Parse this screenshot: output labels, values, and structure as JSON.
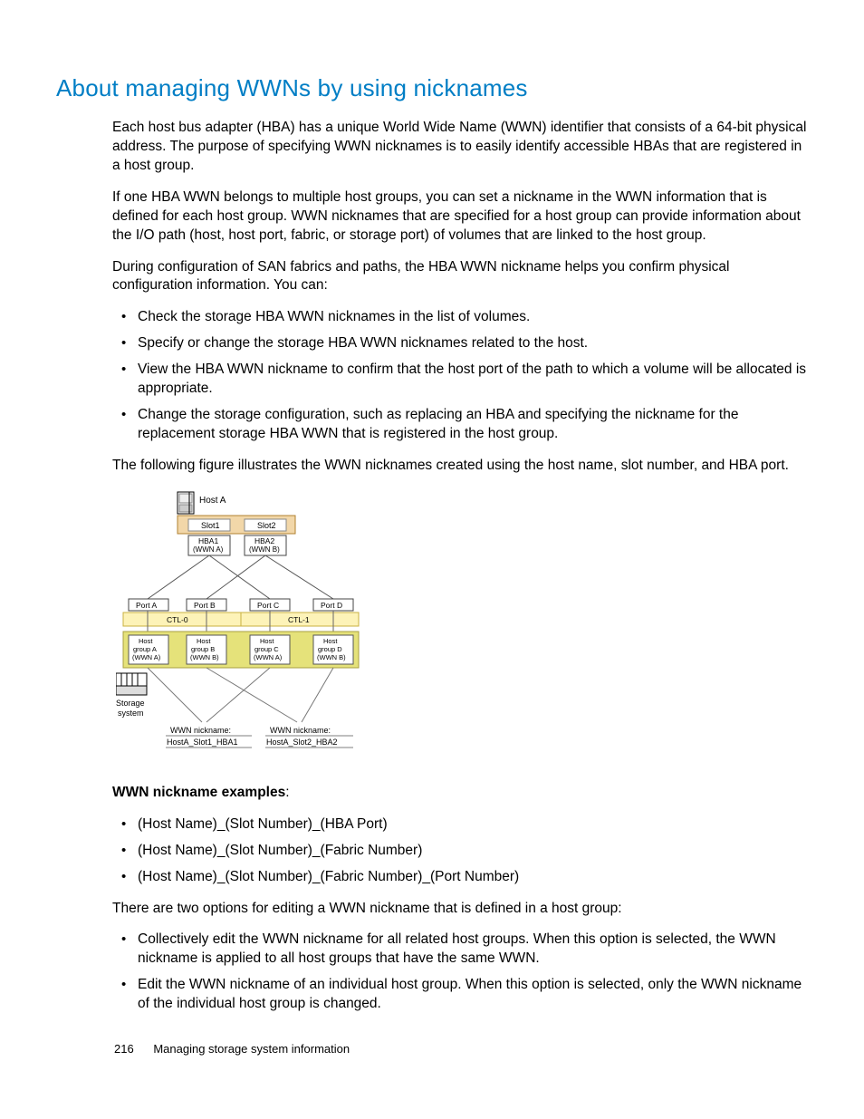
{
  "title": "About managing WWNs by using nicknames",
  "p1": "Each host bus adapter (HBA) has a unique World Wide Name (WWN) identifier that consists of a 64-bit physical address. The purpose of specifying WWN nicknames is to easily identify accessible HBAs that are registered in a host group.",
  "p2": "If one HBA WWN belongs to multiple host groups, you can set a nickname in the WWN information that is defined for each host group. WWN nicknames that are specified for a host group can provide information about the I/O path (host, host port, fabric, or storage port) of volumes that are linked to the host group.",
  "p3": "During configuration of SAN fabrics and paths, the HBA WWN nickname helps you confirm physical configuration information. You can:",
  "list1": [
    "Check the storage HBA WWN nicknames in the list of volumes.",
    "Specify or change the storage HBA WWN nicknames related to the host.",
    "View the HBA WWN nickname to confirm that the host port of the path to which a volume will be allocated is appropriate.",
    "Change the storage configuration, such as replacing an HBA and specifying the nickname for the replacement storage HBA WWN that is registered in the host group."
  ],
  "p4": "The following figure illustrates the WWN nicknames created using the host name, slot number, and HBA port.",
  "fig": {
    "hostA": "Host A",
    "slot1": "Slot1",
    "slot2": "Slot2",
    "hba1": "HBA1",
    "wwnA1": "(WWN A)",
    "hba2": "HBA2",
    "wwnB1": "(WWN B)",
    "portA": "Port A",
    "portB": "Port B",
    "portC": "Port C",
    "portD": "Port D",
    "ctl0": "CTL-0",
    "ctl1": "CTL-1",
    "hg": "Host",
    "hgA": "group A",
    "hgAw": "(WWN A)",
    "hgB": "group B",
    "hgBw": "(WWN B)",
    "hgC": "group C",
    "hgCw": "(WWN A)",
    "hgD": "group D",
    "hgDw": "(WWN B)",
    "storage1": "Storage",
    "storage2": "system",
    "nick": "WWN nickname:",
    "nick1": "HostA_Slot1_HBA1",
    "nick2": "HostA_Slot2_HBA2"
  },
  "examplesLabel": "WWN nickname examples",
  "list2": [
    "(Host Name)_(Slot Number)_(HBA Port)",
    "(Host Name)_(Slot Number)_(Fabric Number)",
    "(Host Name)_(Slot Number)_(Fabric Number)_(Port Number)"
  ],
  "p5": "There are two options for editing a WWN nickname that is defined in a host group:",
  "list3": [
    "Collectively edit the WWN nickname for all related host groups. When this option is selected, the WWN nickname is applied to all host groups that have the same WWN.",
    "Edit the WWN nickname of an individual host group. When this option is selected, only the WWN nickname of the individual host group is changed."
  ],
  "footer": {
    "page": "216",
    "chapter": "Managing storage system information"
  }
}
